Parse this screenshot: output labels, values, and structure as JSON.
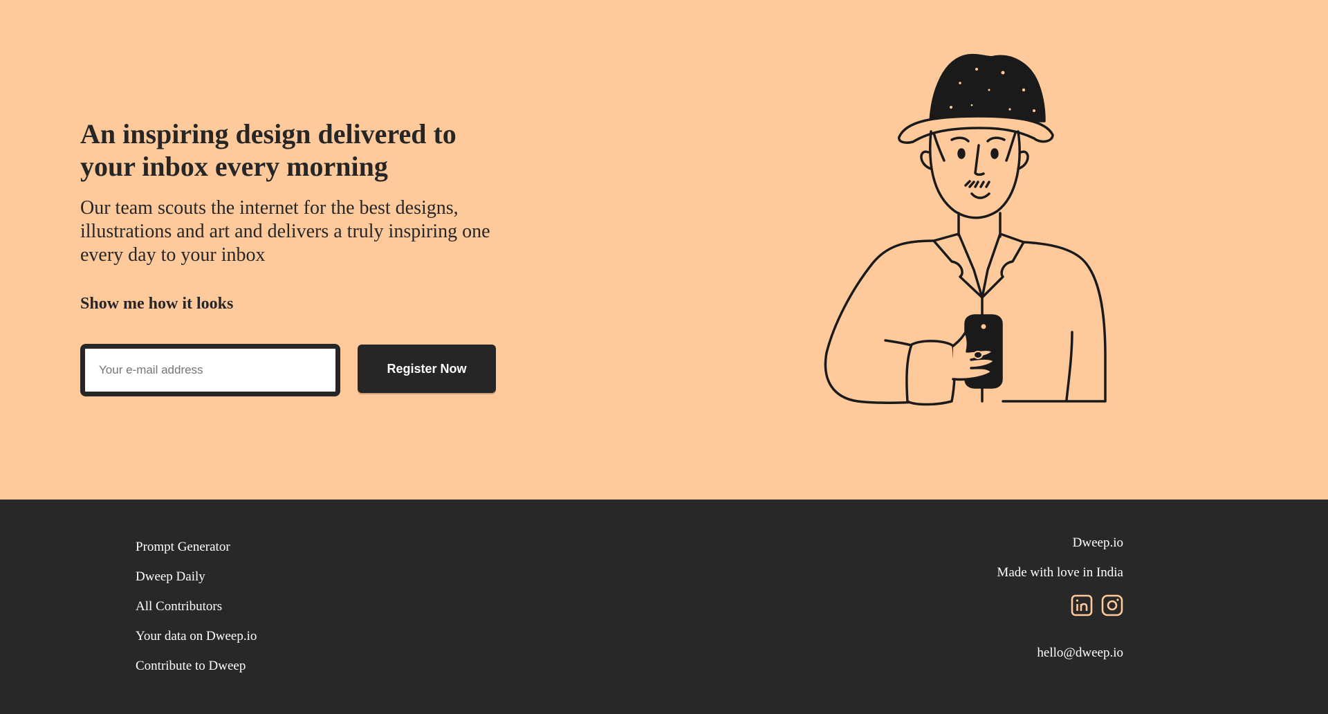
{
  "hero": {
    "headline": "An inspiring design delivered to your inbox every morning",
    "subtext": "Our team scouts the internet for the best designs, illustrations and art and delivers a truly inspiring one every day to your inbox",
    "show_me": "Show me how it looks",
    "email_placeholder": "Your e-mail address",
    "register_label": "Register Now",
    "illustration_icon": "man-with-hat-holding-phone-illustration"
  },
  "footer": {
    "links": [
      "Prompt Generator",
      "Dweep Daily",
      "All Contributors",
      "Your data on Dweep.io",
      "Contribute to Dweep"
    ],
    "brand": "Dweep.io",
    "made_with": "Made with love in India",
    "socials": [
      "linkedin-icon",
      "instagram-icon"
    ],
    "email": "hello@dweep.io"
  },
  "colors": {
    "hero_bg": "#ffca9b",
    "footer_bg": "#282828",
    "dark": "#262626",
    "accent_icon": "#ffca9b"
  }
}
